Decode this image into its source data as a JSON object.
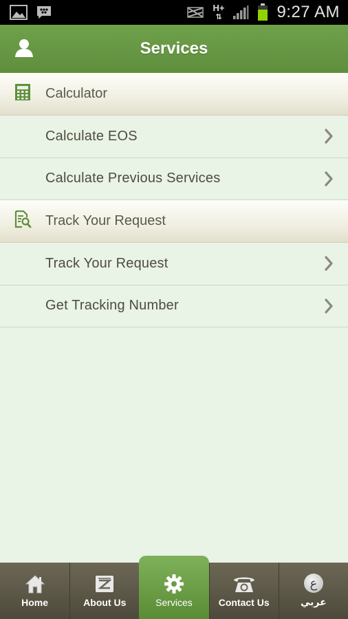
{
  "status_bar": {
    "time": "9:27 AM",
    "network": "H+",
    "icons": [
      "gallery-icon",
      "bbm-icon",
      "mute-icon",
      "network-hplus-icon",
      "signal-icon",
      "battery-icon"
    ]
  },
  "header": {
    "title": "Services",
    "color": "#67984a"
  },
  "sections": [
    {
      "title": "Calculator",
      "icon": "calculator-icon",
      "items": [
        {
          "label": "Calculate EOS"
        },
        {
          "label": "Calculate Previous Services"
        }
      ]
    },
    {
      "title": "Track Your Request",
      "icon": "document-search-icon",
      "items": [
        {
          "label": "Track Your Request"
        },
        {
          "label": "Get Tracking Number"
        }
      ]
    }
  ],
  "tabs": [
    {
      "label": "Home",
      "icon": "home-icon"
    },
    {
      "label": "About Us",
      "icon": "about-icon"
    },
    {
      "label": "Services",
      "icon": "gear-icon",
      "active": true
    },
    {
      "label": "Contact Us",
      "icon": "phone-icon"
    },
    {
      "label": "عربي",
      "icon": "arabic-icon",
      "glyph": "ع"
    }
  ]
}
